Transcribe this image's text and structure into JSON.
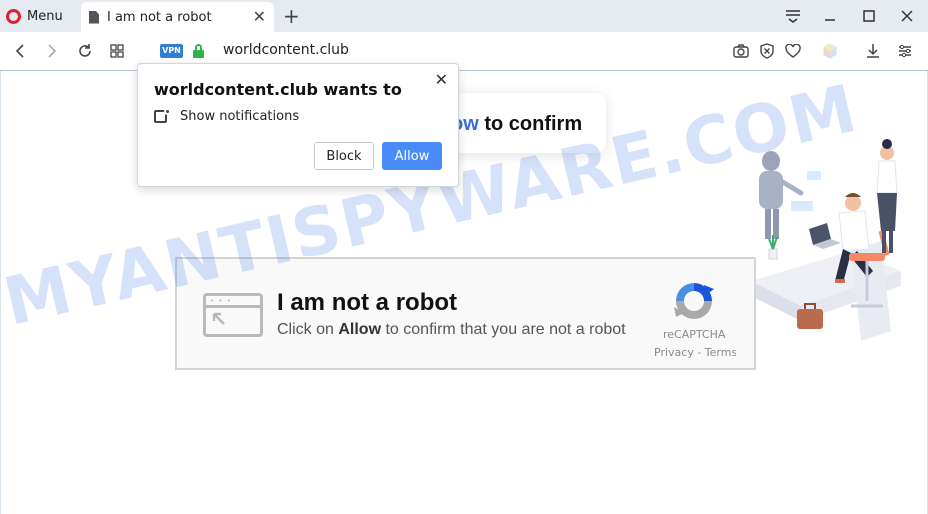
{
  "browser": {
    "menu_label": "Menu",
    "tab_title": "I am not a robot",
    "url": "worldcontent.club",
    "vpn_badge": "VPN"
  },
  "page": {
    "confirm_highlight": "ow",
    "confirm_rest": " to confirm",
    "captcha_title": "I am not a robot",
    "captcha_sub_prefix": "Click on ",
    "captcha_sub_bold": "Allow",
    "captcha_sub_suffix": " to confirm that you are not a robot",
    "recaptcha_name": "reCAPTCHA",
    "recaptcha_links": "Privacy - Terms",
    "watermark": "MYANTISPYWARE.COM"
  },
  "prompt": {
    "title": "worldcontent.club wants to",
    "permission": "Show notifications",
    "block_label": "Block",
    "allow_label": "Allow"
  },
  "colors": {
    "accent": "#4a8cf7",
    "opera_red": "#e0212e",
    "lock_green": "#2db34a",
    "vpn_blue": "#2f7fd4"
  }
}
